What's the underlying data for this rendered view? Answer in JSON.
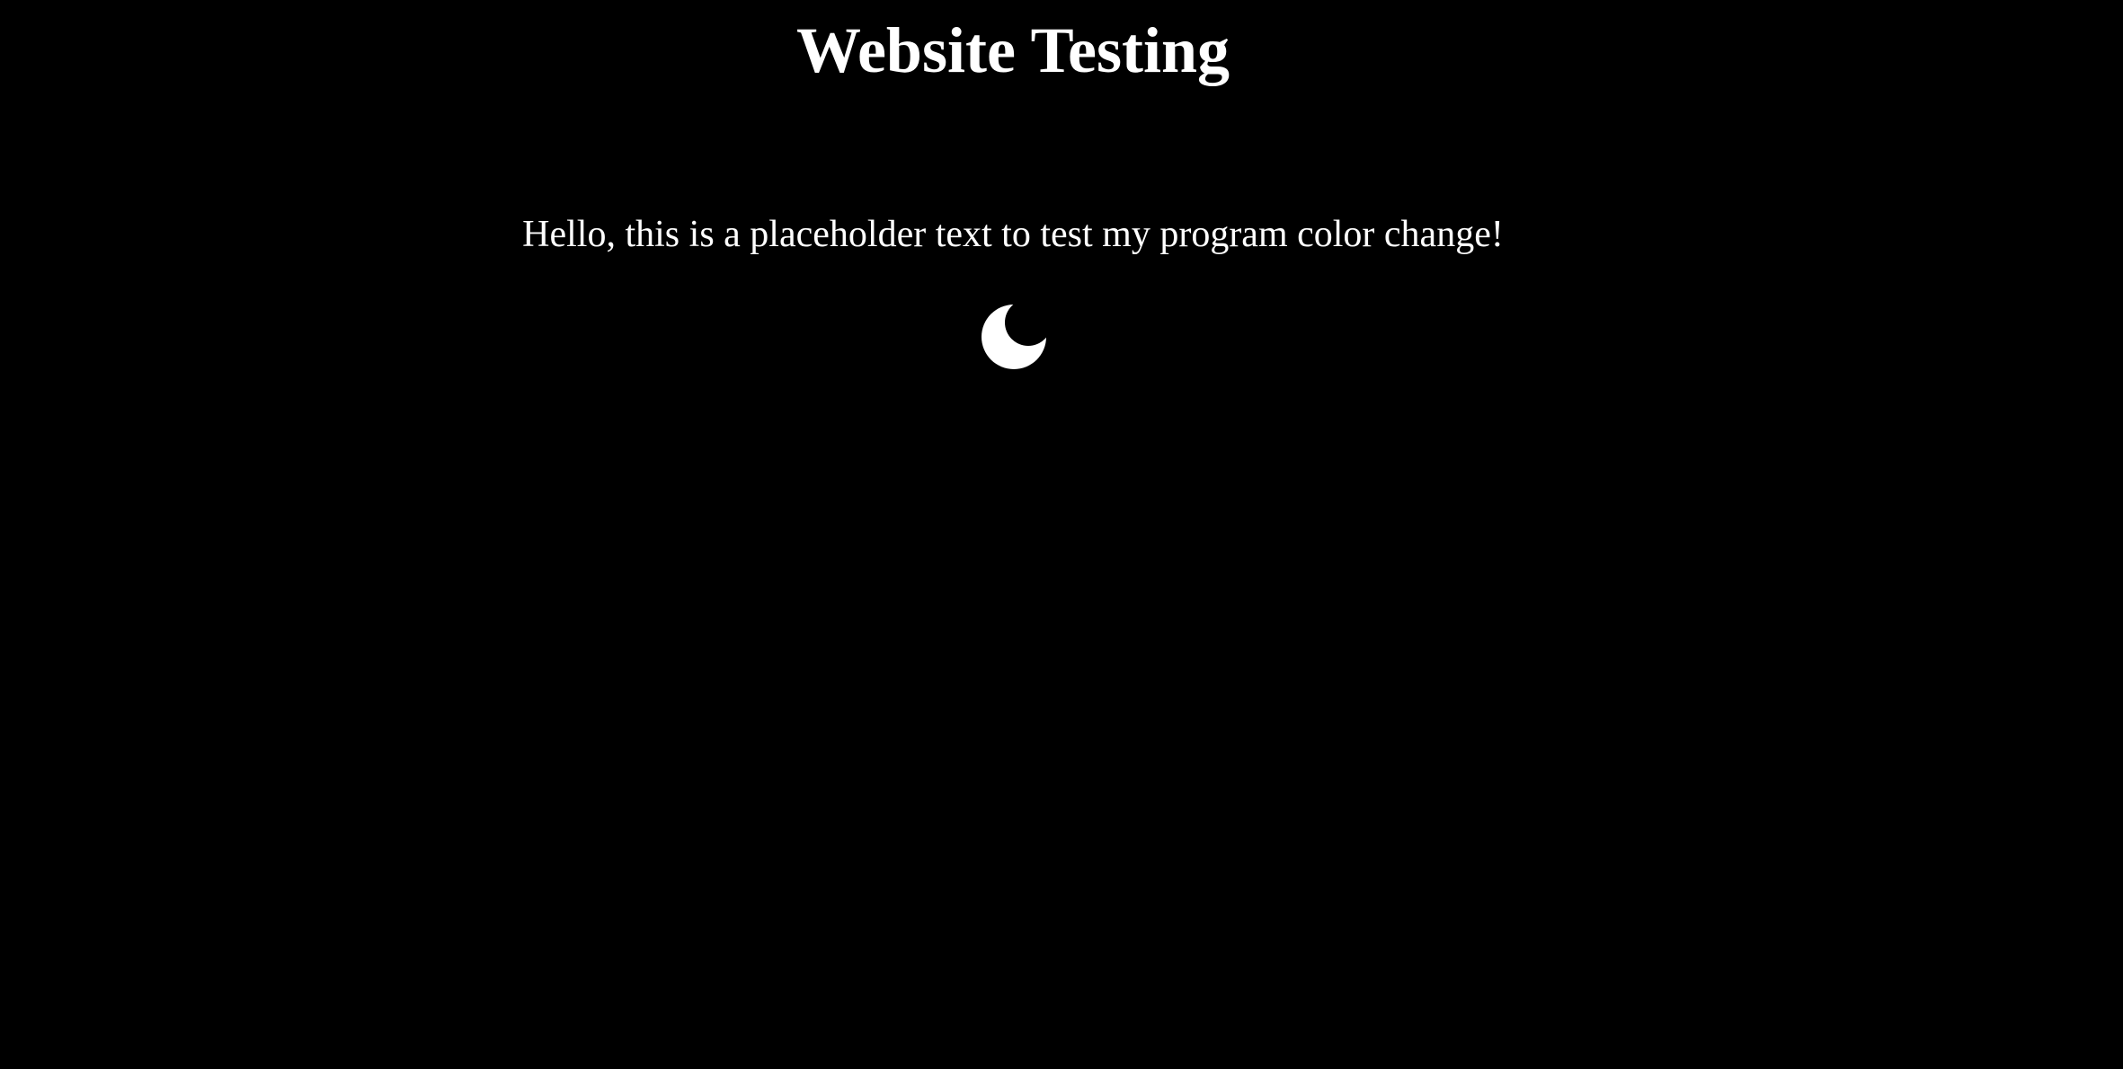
{
  "header": {
    "title": "Website Testing"
  },
  "main": {
    "text": "Hello, this is a placeholder text to test my program color change!",
    "theme_toggle": {
      "icon": "moon-icon"
    }
  },
  "colors": {
    "background": "#000000",
    "text": "#ffffff"
  }
}
